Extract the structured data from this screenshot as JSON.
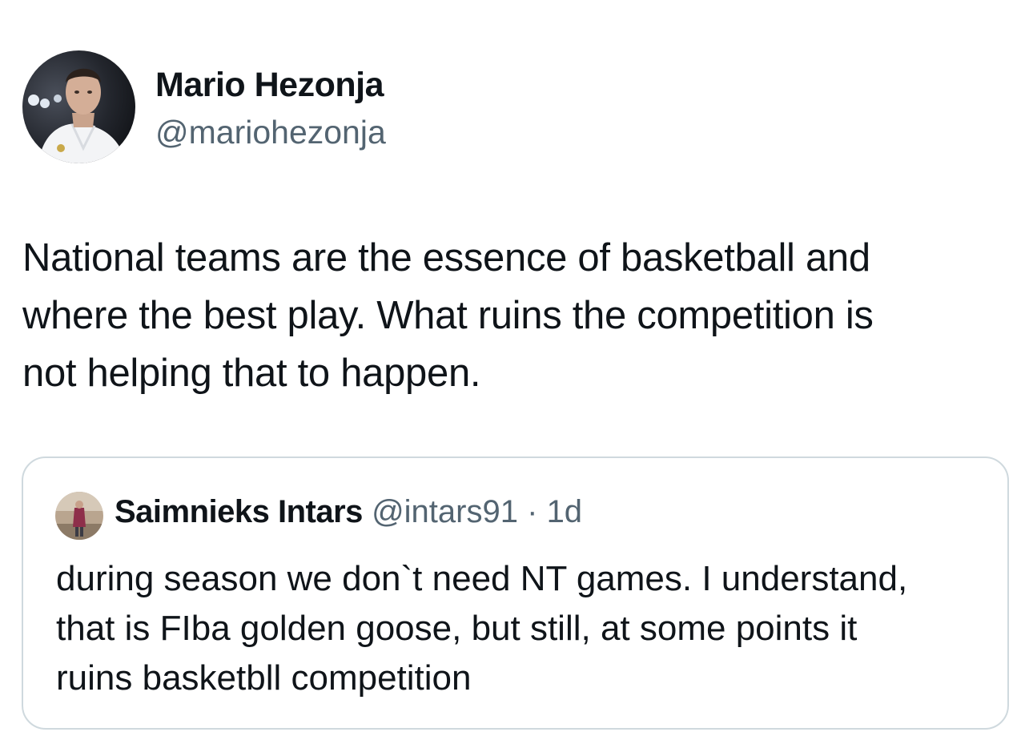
{
  "tweet": {
    "author": {
      "name": "Mario Hezonja",
      "handle": "@mariohezonja"
    },
    "text_lines": [
      "National teams are the essence of basketball and",
      "where the best play. What ruins the competition is",
      "not helping that to happen."
    ]
  },
  "quote": {
    "author": {
      "name": "Saimnieks Intars",
      "handle": "@intars91",
      "separator": "·",
      "time": "1d"
    },
    "text_lines": [
      "during season we don`t need NT games. I understand,",
      "that is FIba golden goose, but still, at some points it",
      "ruins basketbll competition"
    ]
  },
  "colors": {
    "text_primary": "#0f1419",
    "text_secondary": "#536471",
    "border": "#cfd9de"
  }
}
